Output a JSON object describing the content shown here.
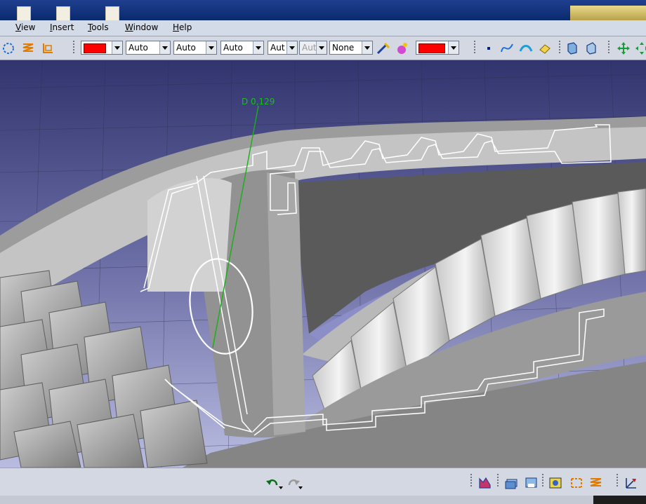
{
  "menubar": {
    "items": [
      "View",
      "Insert",
      "Tools",
      "Window",
      "Help"
    ]
  },
  "toolbar": {
    "fill_color": "#ff0000",
    "line_color": "#ff0000",
    "dropdowns": [
      "Auto",
      "Auto",
      "Auto",
      "Aut",
      "Aut",
      "None"
    ]
  },
  "viewport": {
    "dimension_label": "D 0,129",
    "dimension_color": "#18c018"
  },
  "status_icons": [
    "undo-icon",
    "redo-icon",
    "analysis-icon",
    "layer-icon",
    "save-view-icon",
    "render-icon",
    "swap-icon",
    "multi-icon",
    "axis-icon"
  ]
}
